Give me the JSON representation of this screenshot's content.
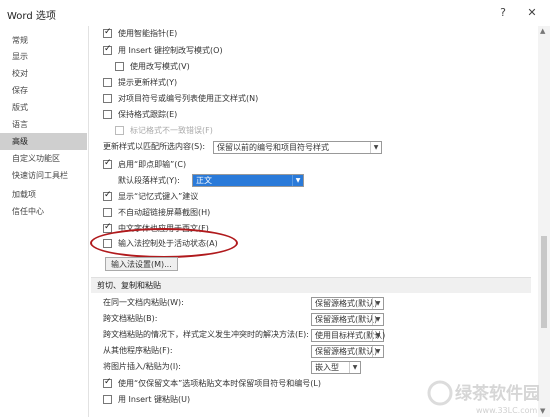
{
  "window": {
    "title": "Word 选项",
    "help": "?",
    "close": "✕"
  },
  "sidebar": {
    "items": [
      {
        "label": "常规"
      },
      {
        "label": "显示"
      },
      {
        "label": "校对"
      },
      {
        "label": "保存"
      },
      {
        "label": "版式"
      },
      {
        "label": "语言"
      },
      {
        "label": "高级"
      },
      {
        "label": "自定义功能区"
      },
      {
        "label": "快速访问工具栏"
      },
      {
        "label": "加载项"
      },
      {
        "label": "信任中心"
      }
    ],
    "active": "高级"
  },
  "options": {
    "smart_pointer": "使用智能指针(E)",
    "insert_key": "用 Insert 键控制改写模式(O)",
    "overtype": "使用改写模式(V)",
    "prompt_update": "提示更新样式(Y)",
    "normal_style": "对项目符号或编号列表使用正文样式(N)",
    "keep_format": "保持格式跟踪(E)",
    "mark_inconsistency": "标记格式不一致错误(F)",
    "update_style_label": "更新样式以匹配所选内容(S):",
    "update_style_value": "保留以前的编号和项目符号样式",
    "click_and_type": "启用“即点即输”(C)",
    "default_para_label": "默认段落样式(Y):",
    "default_para_value": "正文",
    "autocomplete": "显示“记忆式键入”建议",
    "no_hyperlink": "不自动超链接屏幕截图(H)",
    "chinese_font": "中文字体也应用于西文(F)",
    "ime_control": "输入法控制处于活动状态(A)",
    "ime_settings": "输入法设置(M)..."
  },
  "cut_copy_paste": {
    "section_title": "剪切、复制和粘贴",
    "rows": [
      {
        "label": "在同一文档内粘贴(W):",
        "value": "保留源格式(默认)"
      },
      {
        "label": "跨文档粘贴(B):",
        "value": "保留源格式(默认)"
      },
      {
        "label": "跨文档粘贴的情况下，样式定义发生冲突时的解决方法(E):",
        "value": "使用目标样式(默认)"
      },
      {
        "label": "从其他程序粘贴(F):",
        "value": "保留源格式(默认)"
      },
      {
        "label": "将图片插入/粘贴为(I):",
        "value": "嵌入型"
      }
    ],
    "keep_bullets": "使用“仅保留文本”选项粘贴文本时保留项目符号和编号(L)",
    "insert_paste": "用 Insert 键粘贴(U)"
  },
  "watermark": {
    "text": "绿茶软件园",
    "url": "www.33LC.com"
  }
}
